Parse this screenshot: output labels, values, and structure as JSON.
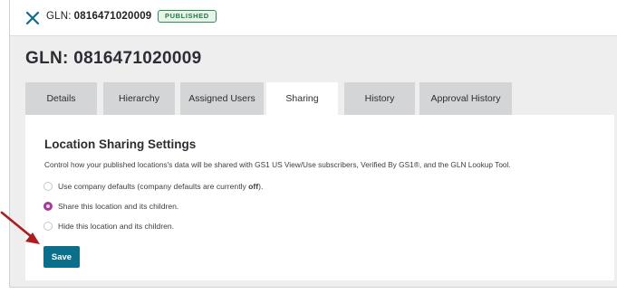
{
  "header": {
    "gln_label": "GLN:",
    "gln_number": "0816471020009",
    "status_badge": "PUBLISHED"
  },
  "page": {
    "title": "GLN: 0816471020009"
  },
  "tabs": [
    {
      "label": "Details",
      "active": false
    },
    {
      "label": "Hierarchy",
      "active": false
    },
    {
      "label": "Assigned Users",
      "active": false
    },
    {
      "label": "Sharing",
      "active": true
    },
    {
      "label": "History",
      "active": false
    },
    {
      "label": "Approval History",
      "active": false
    }
  ],
  "sharing": {
    "heading": "Location Sharing Settings",
    "description": "Control how your published locations's data will be shared with GS1 US View/Use subscribers, Verified By GS1®, and the GLN Lookup Tool.",
    "options": {
      "defaults_prefix": "Use company defaults (company defaults are currently ",
      "defaults_value": "off",
      "defaults_suffix": ").",
      "share": "Share this location and its children.",
      "hide": "Hide this location and its children."
    },
    "selected_option": "share",
    "save_label": "Save"
  },
  "colors": {
    "accent_button": "#0b6e8a",
    "radio_selected": "#a63b98",
    "badge_green": "#2f8d54",
    "annotation_arrow": "#b01c1c"
  },
  "icons": {
    "close": "close-x-icon",
    "annotation": "red-arrow-icon"
  }
}
